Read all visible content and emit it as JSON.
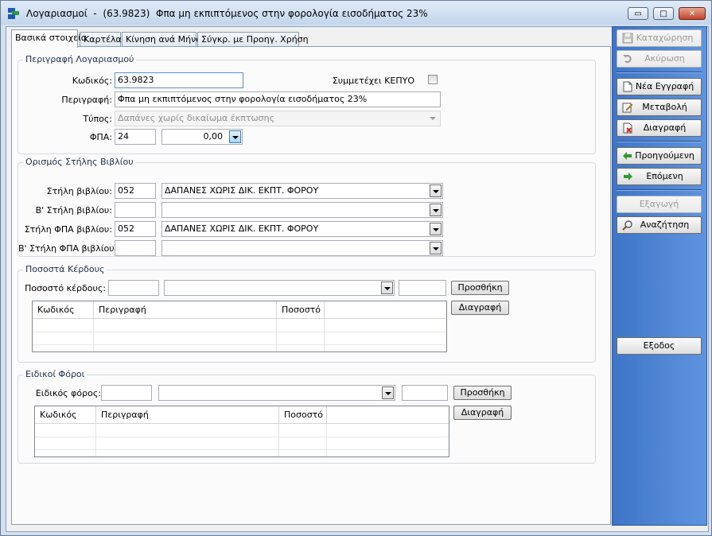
{
  "window": {
    "title": "Λογαριασμοί  -  (63.9823)  Φπα μη εκπιπτόμενος στην φορολογία εισοδήματος 23%",
    "minimize_glyph": "▭",
    "maximize_glyph": "□",
    "close_glyph": "✕"
  },
  "tabs": [
    {
      "label": "Βασικά στοιχεία",
      "active": true
    },
    {
      "label": "Καρτέλα"
    },
    {
      "label": "Κίνηση ανά Μήνα"
    },
    {
      "label": "Σύγκρ. με Προηγ. Χρήση"
    }
  ],
  "description_group": {
    "title": "Περιγραφή Λογαριασμού",
    "code_label": "Κωδικός:",
    "code_value": "63.9823",
    "kepyo_label": "Συμμετέχει ΚΕΠΥΟ",
    "kepyo_checked": false,
    "description_label": "Περιγραφή:",
    "description_value": "Φπα μη εκπιπτόμενος στην φορολογία εισοδήματος 23%",
    "type_label": "Τύπος:",
    "type_value": "Δαπάνες χωρίς δικαίωμα έκπτωσης",
    "vat_label": "ΦΠΑ:",
    "vat_code": "24",
    "vat_rate": "0,00"
  },
  "book_group": {
    "title": "Ορισμός Στήλης Βιβλίου",
    "rows": [
      {
        "label": "Στήλη βιβλίου:",
        "code": "052",
        "desc": "ΔΑΠΑΝΕΣ ΧΩΡΙΣ ΔΙΚ. ΕΚΠΤ. ΦΟΡΟΥ"
      },
      {
        "label": "Β' Στήλη βιβλίου:",
        "code": "",
        "desc": ""
      },
      {
        "label": "Στήλη ΦΠΑ βιβλίου:",
        "code": "052",
        "desc": "ΔΑΠΑΝΕΣ ΧΩΡΙΣ ΔΙΚ. ΕΚΠΤ. ΦΟΡΟΥ"
      },
      {
        "label": "Β' Στήλη ΦΠΑ βιβλίου:",
        "code": "",
        "desc": ""
      }
    ]
  },
  "profit_group": {
    "title": "Ποσοστά Κέρδους",
    "field_label": "Ποσοστό κέρδους:",
    "add_button": "Προσθήκη",
    "delete_button": "Διαγραφή",
    "columns": [
      "Κωδικός",
      "Περιγραφή",
      "Ποσοστό"
    ]
  },
  "tax_group": {
    "title": "Ειδικοί Φόροι",
    "field_label": "Ειδικός φόρος:",
    "add_button": "Προσθήκη",
    "delete_button": "Διαγραφή",
    "columns": [
      "Κωδικός",
      "Περιγραφή",
      "Ποσοστό"
    ]
  },
  "sidebar": {
    "save": "Καταχώρηση",
    "cancel": "Ακύρωση",
    "new": "Νέα Εγγραφή",
    "edit": "Μεταβολή",
    "delete": "Διαγραφή",
    "previous": "Προηγούμενη",
    "next": "Επόμενη",
    "export": "Εξαγωγή",
    "search": "Αναζήτηση",
    "exit": "Εξοδος"
  }
}
